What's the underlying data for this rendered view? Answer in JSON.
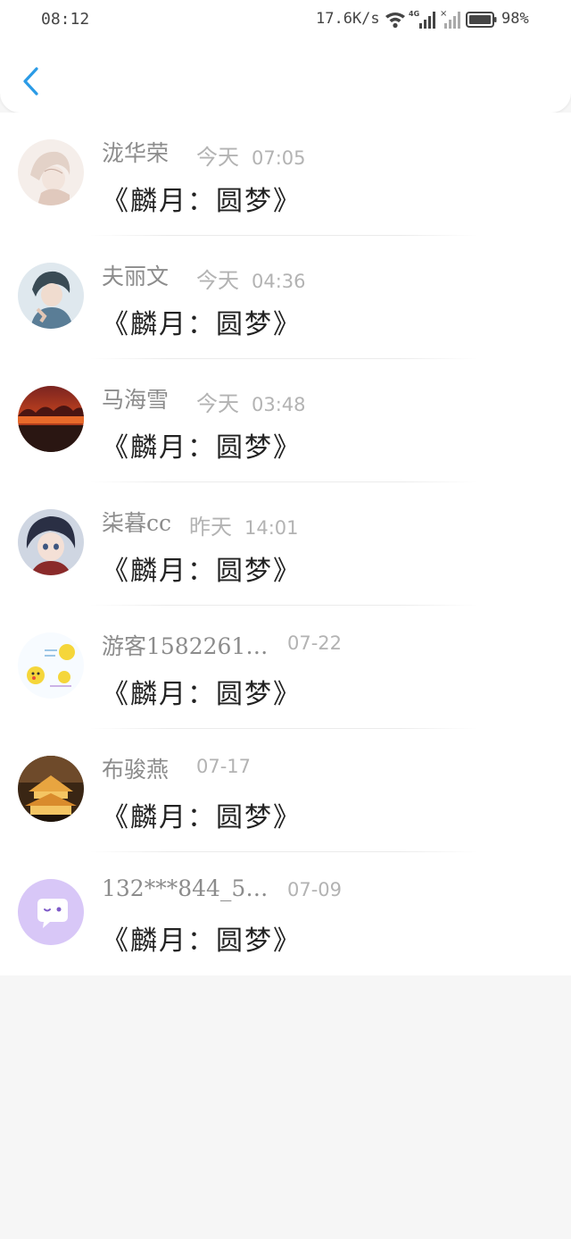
{
  "status_bar": {
    "time": "08:12",
    "network_speed": "17.6K/s",
    "battery_percent": "98%",
    "icons": [
      "wifi-icon",
      "signal-4g-icon",
      "signal-no-sim-icon",
      "battery-icon"
    ]
  },
  "header": {
    "back_icon": "chevron-left-icon",
    "accent_color": "#2b9be6"
  },
  "messages": [
    {
      "name": "泷华荣",
      "day": "今天",
      "time": "07:05",
      "text": "《麟月：圆梦》"
    },
    {
      "name": "夫丽文",
      "day": "今天",
      "time": "04:36",
      "text": "《麟月：圆梦》"
    },
    {
      "name": "马海雪",
      "day": "今天",
      "time": "03:48",
      "text": "《麟月：圆梦》"
    },
    {
      "name": "柒暮cc",
      "day": "昨天",
      "time": "14:01",
      "text": "《麟月：圆梦》"
    },
    {
      "name": "游客1582261…",
      "day": "",
      "time": "07-22",
      "text": "《麟月：圆梦》"
    },
    {
      "name": "布骏燕",
      "day": "",
      "time": "07-17",
      "text": "《麟月：圆梦》"
    },
    {
      "name": "132***844_5…",
      "day": "",
      "time": "07-09",
      "text": "《麟月：圆梦》"
    }
  ]
}
